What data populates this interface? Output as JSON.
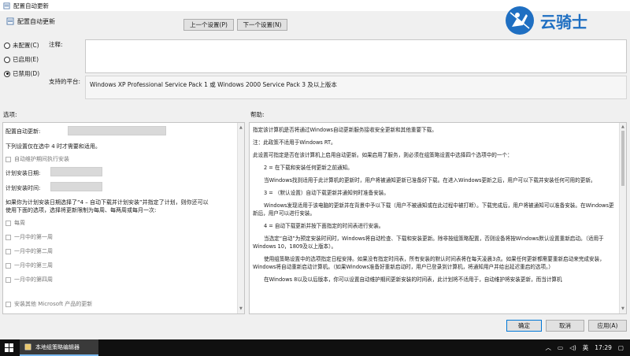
{
  "window": {
    "title": "配置自动更新"
  },
  "header": {
    "policy_title": "配置自动更新",
    "prev_label": "上一个设置(P)",
    "next_label": "下一个设置(N)"
  },
  "state_options": [
    {
      "label": "未配置(C)",
      "checked": false
    },
    {
      "label": "已启用(E)",
      "checked": false
    },
    {
      "label": "已禁用(D)",
      "checked": true
    }
  ],
  "comment": {
    "label": "注释:",
    "value": ""
  },
  "platform": {
    "label": "支持的平台:",
    "value": "Windows XP Professional Service Pack 1 或 Windows 2000 Service Pack 3 及以上版本"
  },
  "options": {
    "heading": "选项:",
    "configure_label": "配置自动更新:",
    "restart_text": "下列设置仅在选中 4 时才需要和适用。",
    "maintenance_label": "自动维护期间执行安装",
    "day_label": "计划安装日期:",
    "time_label": "计划安装时间:",
    "note_line1": "如果你为计划安装日期选择了“4 – 自动下载并计划安装”并指定了计划，则你还可以",
    "note_line2": "使用下面的选项，选择将更新限制为每周、每两周或每月一次:",
    "week_options": [
      "每周",
      "一月中的第一周",
      "一月中的第二周",
      "一月中的第三周",
      "一月中的第四周"
    ],
    "other_products": "安装其他 Microsoft 产品的更新"
  },
  "help": {
    "heading": "帮助:",
    "paragraphs": [
      {
        "text": "指定该计算机是否将通过Windows自动更新服务接收安全更新和其他重要下载。",
        "indent": false
      },
      {
        "text": "注：此政策不适用于Windows RT。",
        "indent": false
      },
      {
        "text": "此设置可指定是否在该计算机上启用自动更新。如果启用了服务，则必须在组策略设置中选择四个选项中的一个：",
        "indent": false
      },
      {
        "text": "2 = 在下载和安装任何更新之前通知。",
        "indent": true
      },
      {
        "text": "当Windows找到适用于此计算机的更新时，用户将被通知更新已准备好下载。在进入Windows更新之后，用户可以下载并安装任何可用的更新。",
        "indent": true
      },
      {
        "text": "3 = （默认设置）自动下载更新并通知何时准备安装。",
        "indent": true
      },
      {
        "text": "Windows发现适用于该电脑的更新并在背景中予以下载（用户不被通知或在此过程中被打断）。下载完成后，用户将被通知可以准备安装。在Windows更新后，用户可以进行安装。",
        "indent": true
      },
      {
        "text": "4 = 自动下载更新并按下面指定的时间表进行安装。",
        "indent": true
      },
      {
        "text": "当选定“自动”为预定安装时间时，Windows将自动检查、下载和安装更新。除非按组策略配置，否则设备将按Windows默认设置重新启动。（适用于Windows 10，1809及以上版本）。",
        "indent": true
      },
      {
        "text": "使用组策略设置中的选项指定日程安排。如果没有指定时间表，所有安装的默认时间表将在每天凌晨3点。如果任何更新都需要重新启动来完成安装，Windows将自动重新启动计算机。（如果Windows准备好重新启动时，用户已登录到计算机，将通知用户并给出延迟重启的选项。）",
        "indent": true
      },
      {
        "text": "在Windows 8以及以后版本，你可以设置自动维护期间更新安装的时间表，此计划将不适用于，自动维护将安装更新，而当计算机",
        "indent": true
      }
    ]
  },
  "buttons": {
    "ok": "确定",
    "cancel": "取消",
    "apply": "应用(A)"
  },
  "taskbar": {
    "app_label": "本地组策略编辑器",
    "ime": "英",
    "time": "17:29"
  },
  "watermark": {
    "text": "云骑士"
  },
  "colors": {
    "ok_border": "#0078d7",
    "taskbar": "#101010",
    "watermark": "#1f6fc2"
  }
}
